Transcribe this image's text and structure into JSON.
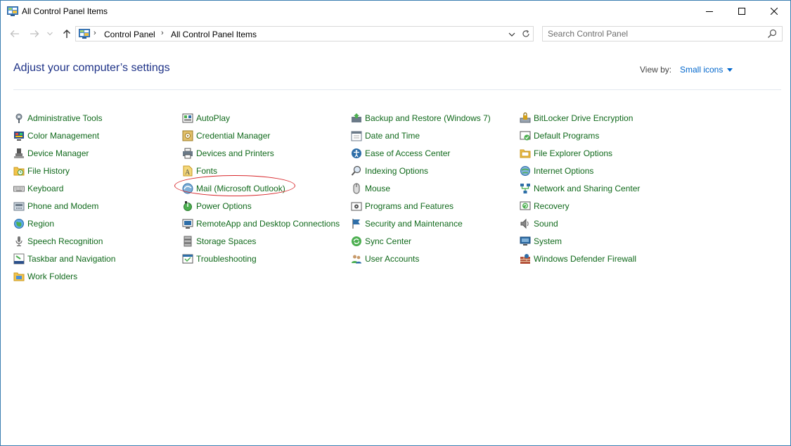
{
  "window": {
    "title": "All Control Panel Items"
  },
  "address": {
    "crumbs": [
      "Control Panel",
      "All Control Panel Items"
    ]
  },
  "search": {
    "placeholder": "Search Control Panel"
  },
  "header": {
    "title": "Adjust your computer’s settings",
    "view_by_label": "View by:",
    "view_by_value": "Small icons"
  },
  "colors": {
    "item_link": "#10691b",
    "heading": "#1e3287",
    "view_by": "#0066cc",
    "highlight": "#d8282c"
  },
  "columns": [
    [
      {
        "label": "Administrative Tools",
        "icon": "administrative-tools-icon"
      },
      {
        "label": "Color Management",
        "icon": "color-management-icon"
      },
      {
        "label": "Device Manager",
        "icon": "device-manager-icon"
      },
      {
        "label": "File History",
        "icon": "file-history-icon"
      },
      {
        "label": "Keyboard",
        "icon": "keyboard-icon"
      },
      {
        "label": "Phone and Modem",
        "icon": "phone-modem-icon"
      },
      {
        "label": "Region",
        "icon": "region-icon"
      },
      {
        "label": "Speech Recognition",
        "icon": "microphone-icon"
      },
      {
        "label": "Taskbar and Navigation",
        "icon": "taskbar-icon"
      },
      {
        "label": "Work Folders",
        "icon": "work-folders-icon"
      }
    ],
    [
      {
        "label": "AutoPlay",
        "icon": "autoplay-icon"
      },
      {
        "label": "Credential Manager",
        "icon": "credential-manager-icon"
      },
      {
        "label": "Devices and Printers",
        "icon": "printer-icon"
      },
      {
        "label": "Fonts",
        "icon": "fonts-icon"
      },
      {
        "label": "Mail (Microsoft Outlook)",
        "icon": "mail-icon"
      },
      {
        "label": "Power Options",
        "icon": "power-options-icon"
      },
      {
        "label": "RemoteApp and Desktop Connections",
        "icon": "remoteapp-icon"
      },
      {
        "label": "Storage Spaces",
        "icon": "storage-spaces-icon"
      },
      {
        "label": "Troubleshooting",
        "icon": "troubleshooting-icon"
      }
    ],
    [
      {
        "label": "Backup and Restore (Windows 7)",
        "icon": "backup-restore-icon"
      },
      {
        "label": "Date and Time",
        "icon": "date-time-icon"
      },
      {
        "label": "Ease of Access Center",
        "icon": "ease-of-access-icon"
      },
      {
        "label": "Indexing Options",
        "icon": "indexing-options-icon"
      },
      {
        "label": "Mouse",
        "icon": "mouse-icon"
      },
      {
        "label": "Programs and Features",
        "icon": "programs-features-icon"
      },
      {
        "label": "Security and Maintenance",
        "icon": "flag-icon"
      },
      {
        "label": "Sync Center",
        "icon": "sync-center-icon"
      },
      {
        "label": "User Accounts",
        "icon": "user-accounts-icon"
      }
    ],
    [
      {
        "label": "BitLocker Drive Encryption",
        "icon": "bitlocker-icon"
      },
      {
        "label": "Default Programs",
        "icon": "default-programs-icon"
      },
      {
        "label": "File Explorer Options",
        "icon": "file-explorer-options-icon"
      },
      {
        "label": "Internet Options",
        "icon": "internet-options-icon"
      },
      {
        "label": "Network and Sharing Center",
        "icon": "network-icon"
      },
      {
        "label": "Recovery",
        "icon": "recovery-icon"
      },
      {
        "label": "Sound",
        "icon": "speaker-icon"
      },
      {
        "label": "System",
        "icon": "system-icon"
      },
      {
        "label": "Windows Defender Firewall",
        "icon": "firewall-icon"
      }
    ]
  ],
  "highlighted_item": "Mail (Microsoft Outlook)"
}
